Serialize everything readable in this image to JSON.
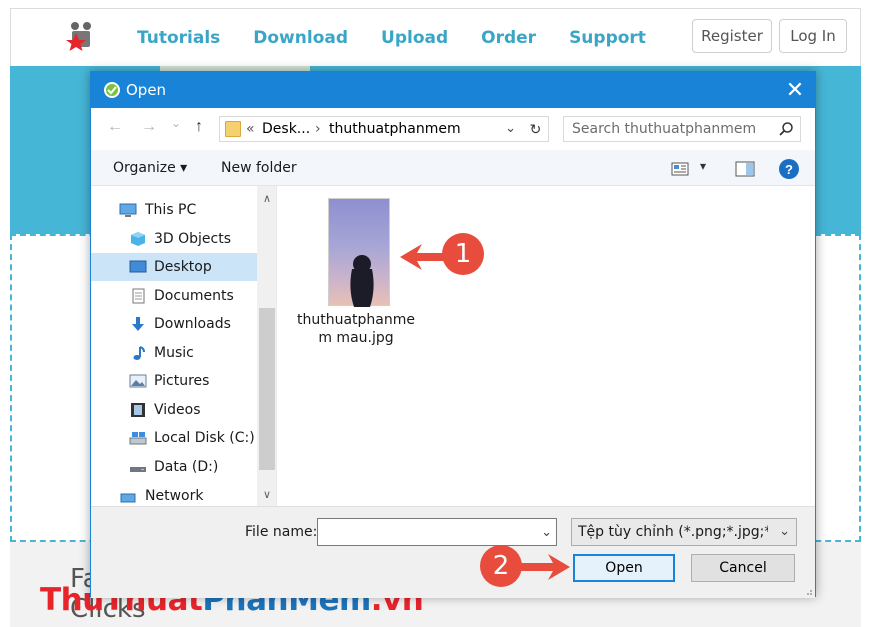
{
  "site": {
    "nav": [
      "Tutorials",
      "Download",
      "Upload",
      "Order",
      "Support"
    ],
    "register_label": "Register",
    "login_label": "Log In",
    "bottom_text_1": "Fa",
    "bottom_text_2": "Clicks",
    "watermark_part1": "ThuThuat",
    "watermark_part2": "PhanMem",
    "watermark_part3": ".vn"
  },
  "dialog": {
    "title": "Open",
    "close_glyph": "✕",
    "back_glyph": "←",
    "forward_glyph": "→",
    "recent_glyph": "⌄",
    "up_glyph": "↑",
    "address": {
      "prefix": "«",
      "seg1": "Desk...",
      "sep": "›",
      "seg2": "thuthuatphanmem",
      "dropdown_glyph": "⌄",
      "refresh_glyph": "↻"
    },
    "search_placeholder": "Search thuthuatphanmem",
    "toolbar": {
      "organize_label": "Organize ▾",
      "new_folder_label": "New folder",
      "view_dropdown_glyph": "▾",
      "help_glyph": "?"
    },
    "nav_items": [
      {
        "label": "This PC",
        "icon": "computer-icon"
      },
      {
        "label": "3D Objects",
        "icon": "cube-icon"
      },
      {
        "label": "Desktop",
        "icon": "desktop-icon",
        "selected": true
      },
      {
        "label": "Documents",
        "icon": "document-icon"
      },
      {
        "label": "Downloads",
        "icon": "download-arrow-icon"
      },
      {
        "label": "Music",
        "icon": "music-note-icon"
      },
      {
        "label": "Pictures",
        "icon": "pictures-icon"
      },
      {
        "label": "Videos",
        "icon": "film-icon"
      },
      {
        "label": "Local Disk (C:)",
        "icon": "drive-icon"
      },
      {
        "label": "Data (D:)",
        "icon": "drive-icon"
      },
      {
        "label": "Network",
        "icon": "network-icon"
      }
    ],
    "scroll_up_glyph": "∧",
    "scroll_down_glyph": "∨",
    "file": {
      "name": "thuthuatphanmem mau.jpg",
      "name_line1": "thuthuatphanme",
      "name_line2": "m mau.jpg"
    },
    "file_name_label": "File name:",
    "file_name_value": "",
    "file_name_dropdown_glyph": "⌄",
    "file_type": "Tệp tùy chỉnh (*.png;*.jpg;*.jpe",
    "file_type_dropdown_glyph": "⌄",
    "open_label": "Open",
    "cancel_label": "Cancel"
  },
  "annotations": {
    "step1": "1",
    "step2": "2"
  },
  "colors": {
    "accent": "#1883d7",
    "site_blue": "#46b6d7",
    "annotation_red": "#e74c3c",
    "selection": "#cce4f7"
  }
}
